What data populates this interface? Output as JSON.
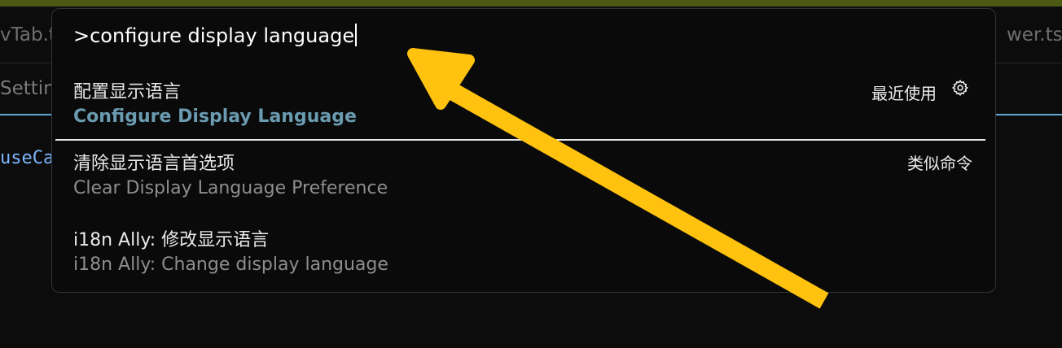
{
  "background": {
    "tab_left": "vTab.t",
    "tab_right": "wer.tsx",
    "settings_text": "Setting",
    "code_text": "useCa"
  },
  "palette": {
    "input_value": ">configure display language",
    "items": [
      {
        "zh": "配置显示语言",
        "en": "Configure Display Language",
        "right_label": "最近使用",
        "right_icon": "gear-icon",
        "selected": true
      },
      {
        "zh": "清除显示语言首选项",
        "en": "Clear Display Language Preference",
        "right_label": "类似命令"
      },
      {
        "zh": "i18n Ally: 修改显示语言",
        "en": "i18n Ally: Change display language"
      }
    ]
  },
  "colors": {
    "accent_arrow": "#ffc20e",
    "active_en_text": "#6a9bb0",
    "top_strip": "#4d5a14",
    "editor_blue_line": "#5fa8d3"
  }
}
